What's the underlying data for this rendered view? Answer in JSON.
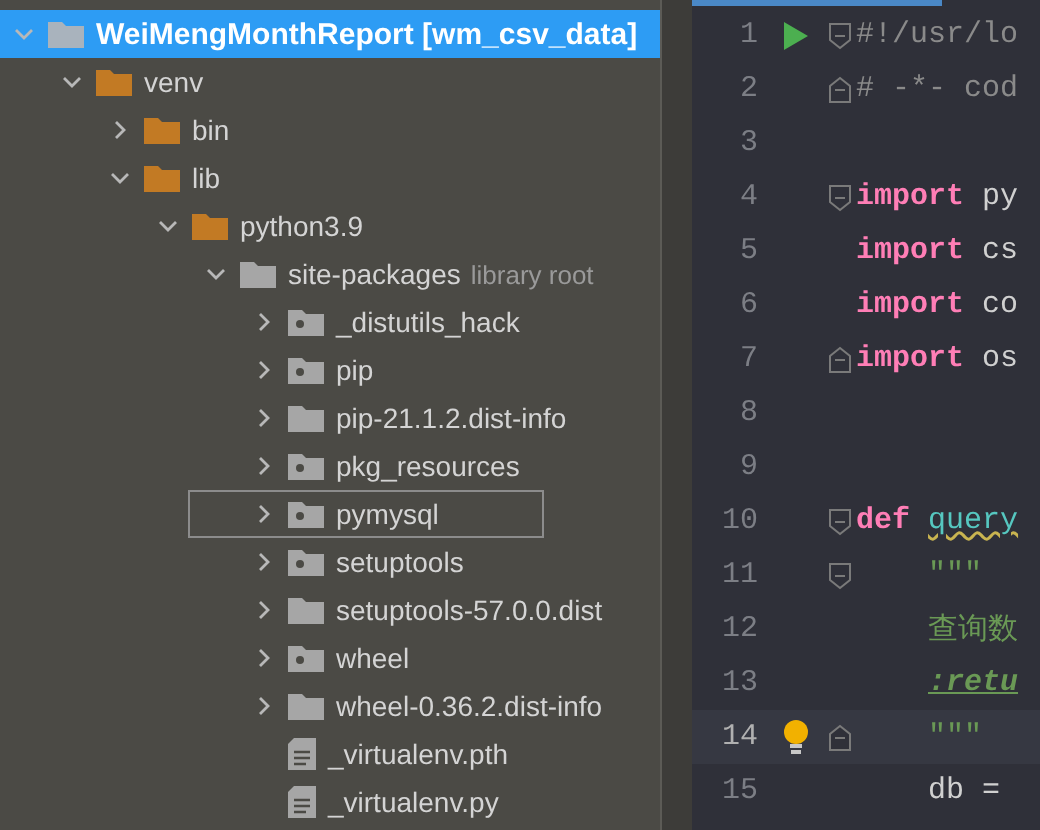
{
  "project_tree": [
    {
      "label": "WeiMengMonthReport [wm_csv_data]",
      "kind": "root-folder",
      "expanded": true,
      "selected": true,
      "focused": false,
      "children": [
        {
          "label": "venv",
          "kind": "excluded-folder",
          "expanded": true,
          "selected": false,
          "focused": false,
          "children": [
            {
              "label": "bin",
              "kind": "excluded-folder",
              "expanded": false,
              "selected": false,
              "focused": false
            },
            {
              "label": "lib",
              "kind": "excluded-folder",
              "expanded": true,
              "selected": false,
              "focused": false,
              "children": [
                {
                  "label": "python3.9",
                  "kind": "excluded-folder",
                  "expanded": true,
                  "selected": false,
                  "focused": false,
                  "children": [
                    {
                      "label": "site-packages",
                      "hint": "library root",
                      "kind": "folder",
                      "expanded": true,
                      "selected": false,
                      "focused": false,
                      "children": [
                        {
                          "label": "_distutils_hack",
                          "kind": "package",
                          "expanded": false,
                          "selected": false,
                          "focused": false
                        },
                        {
                          "label": "pip",
                          "kind": "package",
                          "expanded": false,
                          "selected": false,
                          "focused": false
                        },
                        {
                          "label": "pip-21.1.2.dist-info",
                          "kind": "folder",
                          "expanded": false,
                          "selected": false,
                          "focused": false
                        },
                        {
                          "label": "pkg_resources",
                          "kind": "package",
                          "expanded": false,
                          "selected": false,
                          "focused": false
                        },
                        {
                          "label": "pymysql",
                          "kind": "package",
                          "expanded": false,
                          "selected": false,
                          "focused": true
                        },
                        {
                          "label": "setuptools",
                          "kind": "package",
                          "expanded": false,
                          "selected": false,
                          "focused": false
                        },
                        {
                          "label": "setuptools-57.0.0.dist",
                          "kind": "folder",
                          "expanded": false,
                          "selected": false,
                          "focused": false
                        },
                        {
                          "label": "wheel",
                          "kind": "package",
                          "expanded": false,
                          "selected": false,
                          "focused": false
                        },
                        {
                          "label": "wheel-0.36.2.dist-info",
                          "kind": "folder",
                          "expanded": false,
                          "selected": false,
                          "focused": false
                        },
                        {
                          "label": "_virtualenv.pth",
                          "kind": "file",
                          "selected": false,
                          "focused": false
                        },
                        {
                          "label": "_virtualenv.py",
                          "kind": "file",
                          "selected": false,
                          "focused": false
                        }
                      ]
                    }
                  ]
                }
              ]
            }
          ]
        }
      ]
    }
  ],
  "editor": {
    "lines": [
      {
        "number": "1",
        "runnable": true,
        "intention_bulb": false,
        "fold_start": true,
        "fold_end": false,
        "current": false,
        "indented": false,
        "tokens": [
          {
            "text": "#!/usr/lo",
            "kind": "comment"
          }
        ]
      },
      {
        "number": "2",
        "runnable": false,
        "intention_bulb": false,
        "fold_start": false,
        "fold_end": true,
        "current": false,
        "indented": false,
        "tokens": [
          {
            "text": "# -*- cod",
            "kind": "comment"
          }
        ]
      },
      {
        "number": "3",
        "runnable": false,
        "intention_bulb": false,
        "fold_start": false,
        "fold_end": false,
        "current": false
      },
      {
        "number": "4",
        "runnable": false,
        "intention_bulb": false,
        "fold_start": true,
        "fold_end": false,
        "current": false,
        "indented": false,
        "tokens": [
          {
            "text": "import",
            "kind": "keyword"
          },
          {
            "text": "py",
            "kind": "plain"
          }
        ]
      },
      {
        "number": "5",
        "runnable": false,
        "intention_bulb": false,
        "fold_start": false,
        "fold_end": false,
        "current": false,
        "indented": false,
        "tokens": [
          {
            "text": "import",
            "kind": "keyword"
          },
          {
            "text": "cs",
            "kind": "plain"
          }
        ]
      },
      {
        "number": "6",
        "runnable": false,
        "intention_bulb": false,
        "fold_start": false,
        "fold_end": false,
        "current": false,
        "indented": false,
        "tokens": [
          {
            "text": "import",
            "kind": "keyword"
          },
          {
            "text": "co",
            "kind": "plain"
          }
        ]
      },
      {
        "number": "7",
        "runnable": false,
        "intention_bulb": false,
        "fold_start": false,
        "fold_end": true,
        "current": false,
        "indented": false,
        "tokens": [
          {
            "text": "import",
            "kind": "keyword"
          },
          {
            "text": "os",
            "kind": "plain"
          }
        ]
      },
      {
        "number": "8",
        "runnable": false,
        "intention_bulb": false,
        "fold_start": false,
        "fold_end": false,
        "current": false
      },
      {
        "number": "9",
        "runnable": false,
        "intention_bulb": false,
        "fold_start": false,
        "fold_end": false,
        "current": false
      },
      {
        "number": "10",
        "runnable": false,
        "intention_bulb": false,
        "fold_start": true,
        "fold_end": false,
        "current": false,
        "indented": false,
        "tokens": [
          {
            "text": "def",
            "kind": "keyword"
          },
          {
            "text": "query",
            "kind": "function-warning"
          }
        ]
      },
      {
        "number": "11",
        "runnable": false,
        "intention_bulb": false,
        "fold_start": true,
        "fold_end": false,
        "current": false,
        "indented": true,
        "tokens": [
          {
            "text": "\"\"\"",
            "kind": "docstring"
          }
        ]
      },
      {
        "number": "12",
        "runnable": false,
        "intention_bulb": false,
        "fold_start": false,
        "fold_end": false,
        "current": false,
        "indented": true,
        "tokens": [
          {
            "text": "查询数",
            "kind": "docstring"
          }
        ]
      },
      {
        "number": "13",
        "runnable": false,
        "intention_bulb": false,
        "fold_start": false,
        "fold_end": false,
        "current": false,
        "indented": true,
        "tokens": [
          {
            "text": ":retu",
            "kind": "doc-tag"
          }
        ]
      },
      {
        "number": "14",
        "runnable": false,
        "intention_bulb": true,
        "fold_start": false,
        "fold_end": true,
        "current": true,
        "indented": true,
        "tokens": [
          {
            "text": "\"\"\"",
            "kind": "docstring"
          }
        ]
      },
      {
        "number": "15",
        "runnable": false,
        "intention_bulb": false,
        "fold_start": false,
        "fold_end": false,
        "current": false,
        "indented": true,
        "tokens": [
          {
            "text": "db =",
            "kind": "plain"
          }
        ]
      }
    ]
  }
}
